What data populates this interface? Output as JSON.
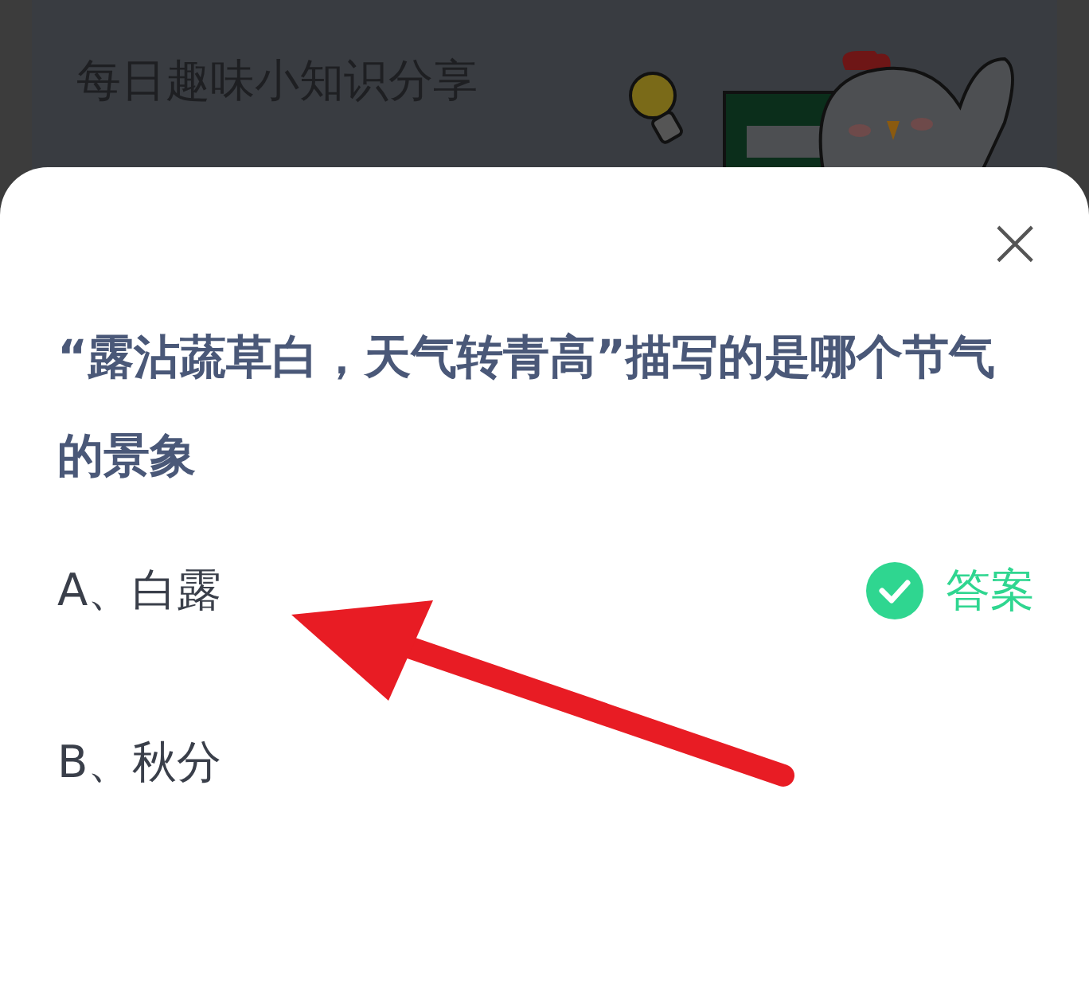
{
  "card": {
    "title": "每日趣味小知识分享"
  },
  "quiz": {
    "close": "×",
    "question": "“露沾蔬草白，天气转青高”描写的是哪个节气的景象",
    "answer_label": "答案",
    "options": [
      {
        "label": "A、白露",
        "correct": true
      },
      {
        "label": "B、秋分",
        "correct": false
      }
    ]
  }
}
